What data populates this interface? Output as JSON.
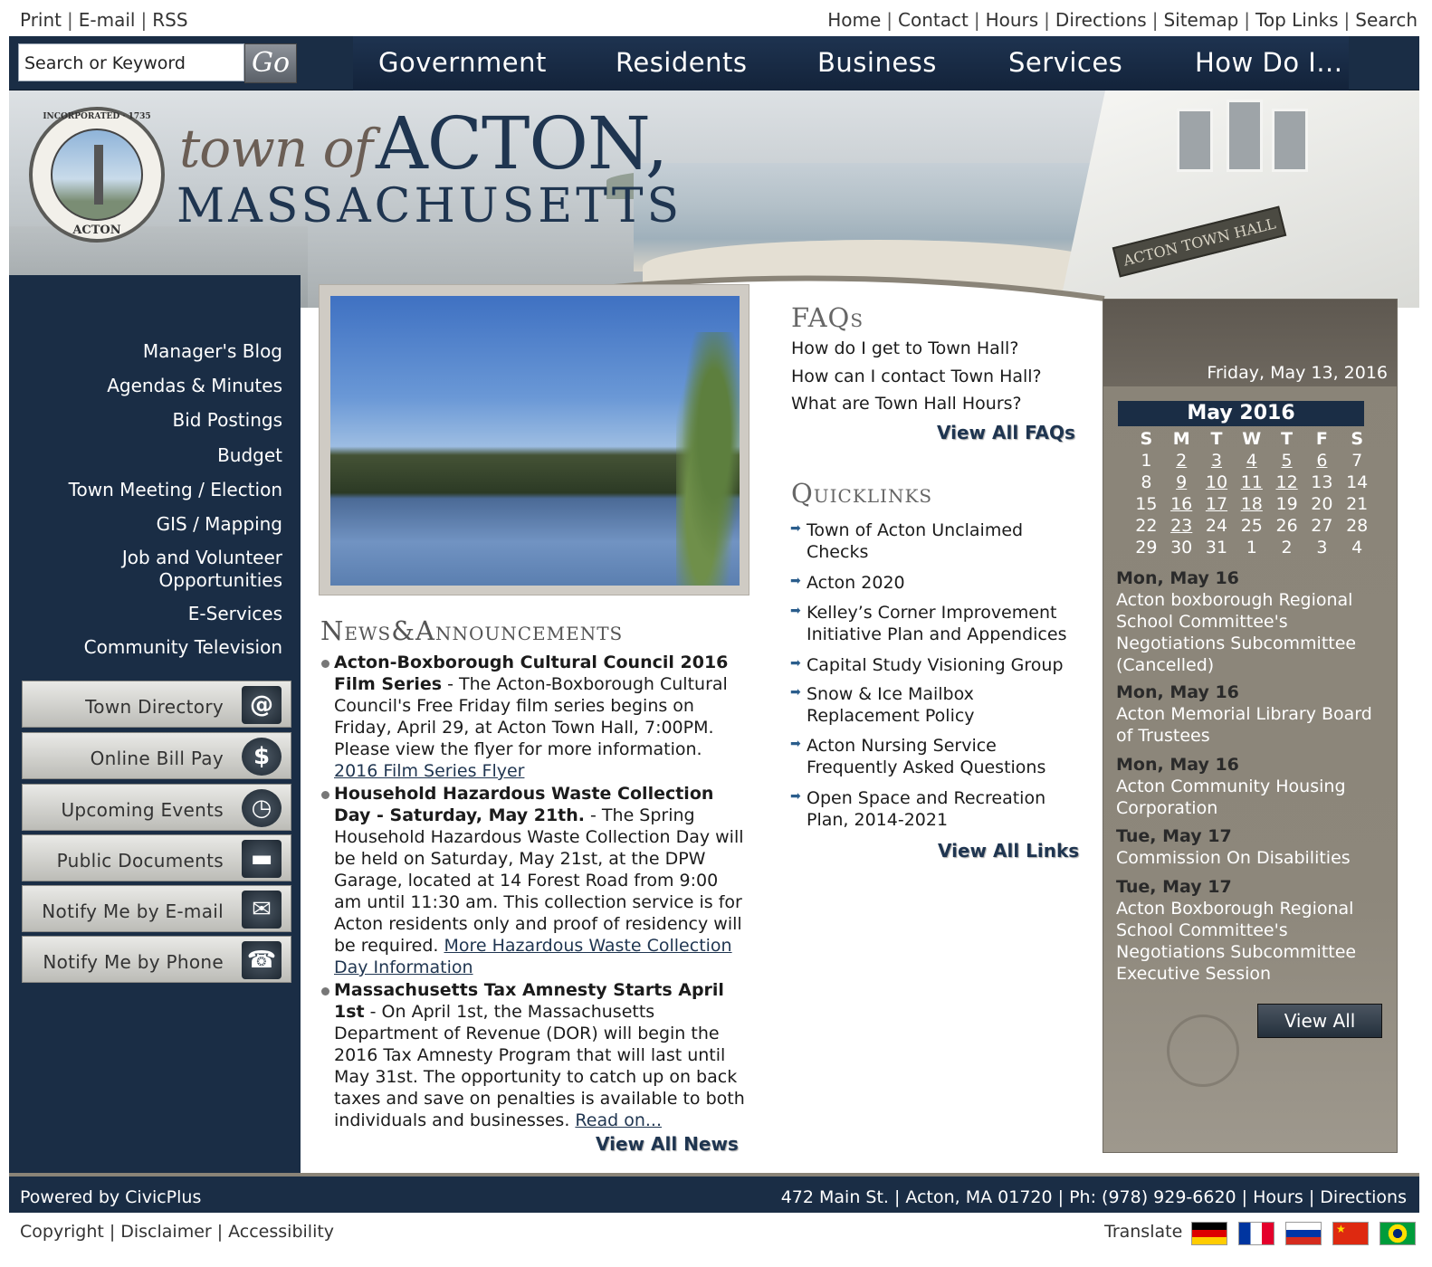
{
  "utility": {
    "left": [
      "Print",
      "E-mail",
      "RSS"
    ],
    "right": [
      "Home",
      "Contact",
      "Hours",
      "Directions",
      "Sitemap",
      "Top Links",
      "Search"
    ]
  },
  "search": {
    "placeholder": "Search or Keyword",
    "go_label": "Go"
  },
  "nav": [
    "Government",
    "Residents",
    "Business",
    "Services",
    "How Do I..."
  ],
  "banner": {
    "logo_town": "town of",
    "logo_acton": "ACTON,",
    "logo_state": "MASSACHUSETTS",
    "seal_top": "INCORPORATED · 1735",
    "seal_bottom": "ACTON",
    "sign_text": "ACTON TOWN HALL"
  },
  "sidebar": {
    "links": [
      "Manager's Blog",
      "Agendas & Minutes",
      "Bid Postings",
      "Budget",
      "Town Meeting / Election",
      "GIS / Mapping",
      "Job and Volunteer Opportunities",
      "E-Services",
      "Community Television"
    ],
    "buttons": [
      {
        "label": "Town Directory",
        "icon": "address-book-icon"
      },
      {
        "label": "Online Bill Pay",
        "icon": "dollar-icon"
      },
      {
        "label": "Upcoming Events",
        "icon": "clock-icon"
      },
      {
        "label": "Public Documents",
        "icon": "folder-icon"
      },
      {
        "label": "Notify Me by E-mail",
        "icon": "envelope-icon"
      },
      {
        "label": "Notify Me by Phone",
        "icon": "phone-icon"
      }
    ]
  },
  "news": {
    "heading": "News&Announcements",
    "items": [
      {
        "title": "Acton-Boxborough Cultural Council 2016 Film Series",
        "body": " - The Acton-Boxborough Cultural Council's Free Friday film series begins on Friday, April 29, at Acton Town Hall, 7:00PM. Please view the flyer for more information. ",
        "link": "2016 Film Series Flyer"
      },
      {
        "title": "Household Hazardous Waste Collection Day - Saturday, May 21th.",
        "body": " - The Spring Household Hazardous Waste Collection Day will be held on Saturday, May 21st, at the DPW Garage, located at 14 Forest Road from 9:00 am until 11:30 am. This collection service is for Acton residents only and proof of residency will be required. ",
        "link": "More Hazardous Waste Collection Day Information"
      },
      {
        "title": "Massachusetts Tax Amnesty Starts April 1st",
        "body": " - On April 1st, the Massachusetts Department of Revenue (DOR) will begin the 2016 Tax Amnesty Program that will last until May 31st. The opportunity to catch up on back taxes and save on penalties is available to both individuals and businesses. ",
        "link": "Read on..."
      }
    ],
    "view_all": "View All News"
  },
  "faqs": {
    "heading": "FAQs",
    "items": [
      "How do I get to Town Hall?",
      "How can I contact Town Hall?",
      "What are Town Hall Hours?"
    ],
    "view_all": "View All FAQs"
  },
  "quicklinks": {
    "heading": "Quicklinks",
    "items": [
      "Town of Acton Unclaimed Checks",
      "Acton 2020",
      "Kelley’s Corner Improvement Initiative Plan and Appendices",
      "Capital Study Visioning Group",
      "Snow & Ice Mailbox Replacement Policy",
      "Acton Nursing Service Frequently Asked Questions",
      "Open Space and Recreation Plan, 2014-2021"
    ],
    "view_all": "View All Links"
  },
  "calendar": {
    "today": "Friday, May 13, 2016",
    "month": "May 2016",
    "weekdays": [
      "S",
      "M",
      "T",
      "W",
      "T",
      "F",
      "S"
    ],
    "weeks": [
      [
        "1",
        "2",
        "3",
        "4",
        "5",
        "6",
        "7"
      ],
      [
        "8",
        "9",
        "10",
        "11",
        "12",
        "13",
        "14"
      ],
      [
        "15",
        "16",
        "17",
        "18",
        "19",
        "20",
        "21"
      ],
      [
        "22",
        "23",
        "24",
        "25",
        "26",
        "27",
        "28"
      ],
      [
        "29",
        "30",
        "31",
        "1",
        "2",
        "3",
        "4"
      ]
    ],
    "event_days": [
      "2",
      "3",
      "4",
      "5",
      "6",
      "9",
      "10",
      "11",
      "12",
      "16",
      "17",
      "18",
      "23"
    ],
    "events": [
      {
        "date": "Mon, May 16",
        "title": "Acton boxborough Regional School Committee's Negotiations Subcommittee (Cancelled)"
      },
      {
        "date": "Mon, May 16",
        "title": "Acton Memorial Library Board of Trustees"
      },
      {
        "date": "Mon, May 16",
        "title": "Acton Community Housing Corporation"
      },
      {
        "date": "Tue, May 17",
        "title": "Commission On Disabilities"
      },
      {
        "date": "Tue, May 17",
        "title": "Acton Boxborough Regional School Committee's Negotiations Subcommittee Executive Session"
      }
    ],
    "view_all": "View All"
  },
  "footer": {
    "powered": "Powered by CivicPlus",
    "address": "472 Main St. | Acton, MA 01720 | Ph: (978) 929-6620 | Hours | Directions",
    "bottom_links": [
      "Copyright",
      "Disclaimer",
      "Accessibility"
    ],
    "translate": "Translate",
    "flags": [
      "german-flag-icon",
      "french-flag-icon",
      "russian-flag-icon",
      "chinese-flag-icon",
      "brazilian-flag-icon"
    ]
  },
  "colors": {
    "navy": "#1a2d45",
    "taupe": "#8a8478",
    "link": "#1f3550"
  }
}
